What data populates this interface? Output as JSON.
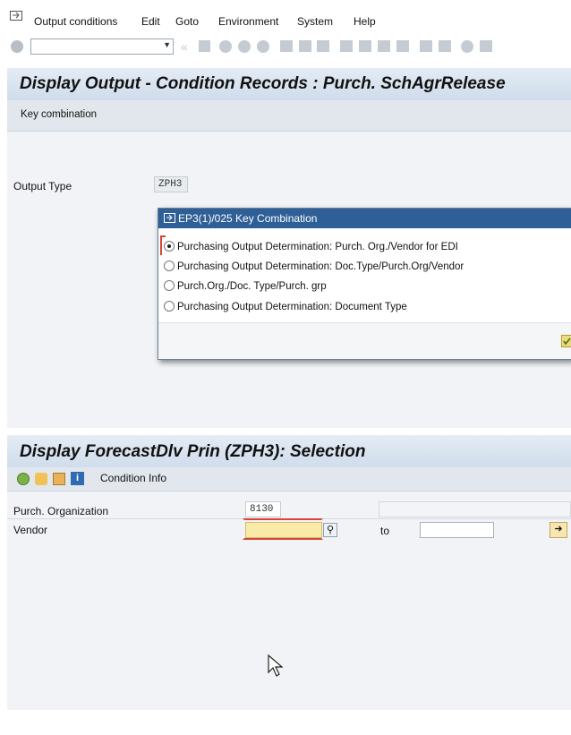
{
  "menubar": {
    "items": [
      {
        "label": "Output conditions"
      },
      {
        "label": "Edit"
      },
      {
        "label": "Goto"
      },
      {
        "label": "Environment"
      },
      {
        "label": "System"
      },
      {
        "label": "Help"
      }
    ]
  },
  "toolbar": {
    "command_field_value": ""
  },
  "screen1": {
    "title": "Display Output - Condition Records : Purch. SchAgrRelease",
    "key_combination_button": "Key combination",
    "output_type_label": "Output Type",
    "output_type_value": "ZPH3"
  },
  "popup": {
    "title": "EP3(1)/025 Key Combination",
    "options": [
      {
        "label": "Purchasing Output Determination: Purch. Org./Vendor for EDI",
        "selected": true
      },
      {
        "label": "Purchasing Output Determination: Doc.Type/Purch.Org/Vendor",
        "selected": false
      },
      {
        "label": "Purch.Org./Doc. Type/Purch. grp",
        "selected": false
      },
      {
        "label": "Purchasing Output Determination: Document Type",
        "selected": false
      }
    ]
  },
  "screen2": {
    "title": "Display ForecastDlv Prin (ZPH3): Selection",
    "condition_info_label": "Condition Info",
    "purch_org_label": "Purch. Organization",
    "purch_org_value": "8130",
    "vendor_label": "Vendor",
    "vendor_value": "",
    "to_label": "to",
    "vendor_to_value": ""
  },
  "colors": {
    "title_bar": "#d6e2ef",
    "popup_header": "#2f5f97",
    "required_field": "#fbe9a7"
  }
}
